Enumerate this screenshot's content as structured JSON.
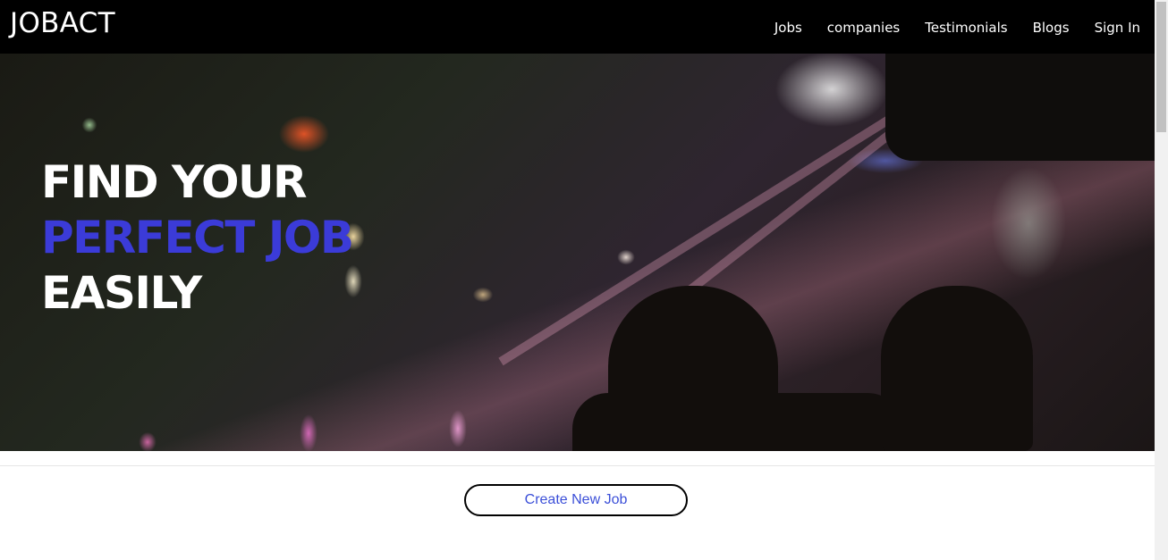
{
  "nav": {
    "brand": "JOBACT",
    "links": [
      "Jobs",
      "companies",
      "Testimonials",
      "Blogs",
      "Sign In"
    ]
  },
  "hero": {
    "line1": "FIND YOUR",
    "line2": "PERFECT JOB",
    "line3": "EASILY",
    "accent_color": "#3b3bd8"
  },
  "actions": {
    "create_job_label": "Create New Job"
  }
}
